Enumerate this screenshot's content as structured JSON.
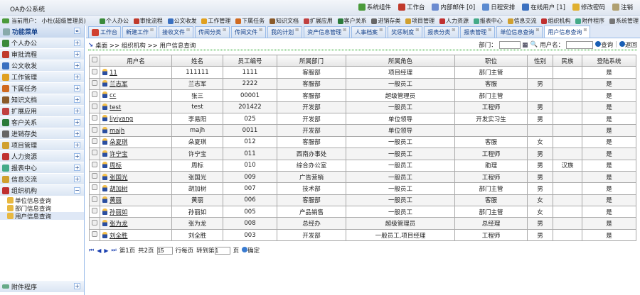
{
  "app": {
    "title": "OA办公系统"
  },
  "top_links": [
    {
      "label": "系统组件",
      "icon": "puzzle-icon"
    },
    {
      "label": "工作台",
      "icon": "home-icon"
    },
    {
      "label": "内部邮件 [0]",
      "icon": "mail-icon"
    },
    {
      "label": "日程安排",
      "icon": "calendar-icon"
    },
    {
      "label": "在线用户 [1]",
      "icon": "user-icon"
    },
    {
      "label": "修改密码",
      "icon": "key-icon"
    },
    {
      "label": "注销",
      "icon": "lock-icon"
    }
  ],
  "current_user": "当前用户： 小杜(超级管理员)",
  "toolbar": [
    "个人办公",
    "审批流程",
    "公文收发",
    "工作管理",
    "下属任务",
    "知识文档",
    "扩展应用",
    "客户关系",
    "进销存类",
    "项目管理",
    "人力资源",
    "报表中心",
    "信息交流",
    "组织机构",
    "附件程序",
    "系统管理"
  ],
  "sidebar": {
    "title": "功能菜单",
    "collapse": "«",
    "items": [
      "个人办公",
      "审批流程",
      "公文收发",
      "工作管理",
      "下属任务",
      "知识文档",
      "扩展应用",
      "客户关系",
      "进销存类",
      "项目管理",
      "人力资源",
      "报表中心",
      "信息交流",
      "组织机构"
    ],
    "subitems": [
      "单位信息查询",
      "部门信息查询",
      "用户信息查询"
    ],
    "footer": "附件程序"
  },
  "tabs": [
    "工作台",
    "新建工作",
    "接收文件",
    "传阅分类",
    "传阅文件",
    "我的计划",
    "资产信息管理",
    "人事档案",
    "奖惩制度",
    "报表分类",
    "报表管理",
    "单位信息查询",
    "用户信息查询"
  ],
  "breadcrumb": "桌面 >> 组织机构 >> 用户信息查询",
  "search": {
    "dept_label": "部门：",
    "dept_value": "",
    "user_label": "用户名：",
    "user_value": "",
    "query": "查询",
    "back": "返回"
  },
  "table": {
    "headers": [
      "用户名",
      "姓名",
      "员工编号",
      "所属部门",
      "所属角色",
      "职位",
      "性别",
      "民族",
      "登陆系统"
    ],
    "rows": [
      [
        "11",
        "111111",
        "1111",
        "客服部",
        "项目经理",
        "部门主管",
        "",
        "",
        "是"
      ],
      [
        "兰志军",
        "兰志军",
        "2222",
        "客服部",
        "一般员工",
        "客服",
        "男",
        "",
        "是"
      ],
      [
        "cc",
        "张三",
        "00001",
        "客服部",
        "超级管理员",
        "部门主管",
        "",
        "",
        "是"
      ],
      [
        "test",
        "test",
        "201422",
        "开发部",
        "一般员工",
        "工程师",
        "男",
        "",
        "是"
      ],
      [
        "liyiyang",
        "李易阳",
        "025",
        "开发部",
        "单位领导",
        "开发实习生",
        "男",
        "",
        "是"
      ],
      [
        "majh",
        "majh",
        "0011",
        "开发部",
        "单位领导",
        "",
        "",
        "",
        "是"
      ],
      [
        "朵夏琪",
        "朵夏琪",
        "012",
        "客服部",
        "一般员工",
        "客服",
        "女",
        "",
        "是"
      ],
      [
        "许宁宝",
        "许宁宝",
        "011",
        "西南办事处",
        "一般员工",
        "工程师",
        "男",
        "",
        "是"
      ],
      [
        "周标",
        "周标",
        "010",
        "综合办公室",
        "一般员工",
        "助理",
        "男",
        "汉族",
        "是"
      ],
      [
        "张国光",
        "张国光",
        "009",
        "广告营销",
        "一般员工",
        "工程师",
        "男",
        "",
        "是"
      ],
      [
        "胡加树",
        "胡加树",
        "007",
        "技术部",
        "一般员工",
        "部门主管",
        "男",
        "",
        "是"
      ],
      [
        "黄丽",
        "黄丽",
        "006",
        "客服部",
        "一般员工",
        "客服",
        "女",
        "",
        "是"
      ],
      [
        "孙丽如",
        "孙丽如",
        "005",
        "产品销售",
        "一般员工",
        "部门主管",
        "女",
        "",
        "是"
      ],
      [
        "张为龙",
        "张为龙",
        "008",
        "总经办",
        "超级管理员",
        "总经理",
        "男",
        "",
        "是"
      ],
      [
        "刘全胜",
        "刘全胜",
        "003",
        "开发部",
        "一般员工,项目经理",
        "工程师",
        "男",
        "",
        "是"
      ]
    ]
  },
  "pager": {
    "page": "第1页",
    "total": "共2页",
    "rows_per_page": "15",
    "rows_label": "行每页",
    "goto_label": "转到第",
    "goto_value": "1",
    "page_unit": "页",
    "confirm": "确定"
  }
}
